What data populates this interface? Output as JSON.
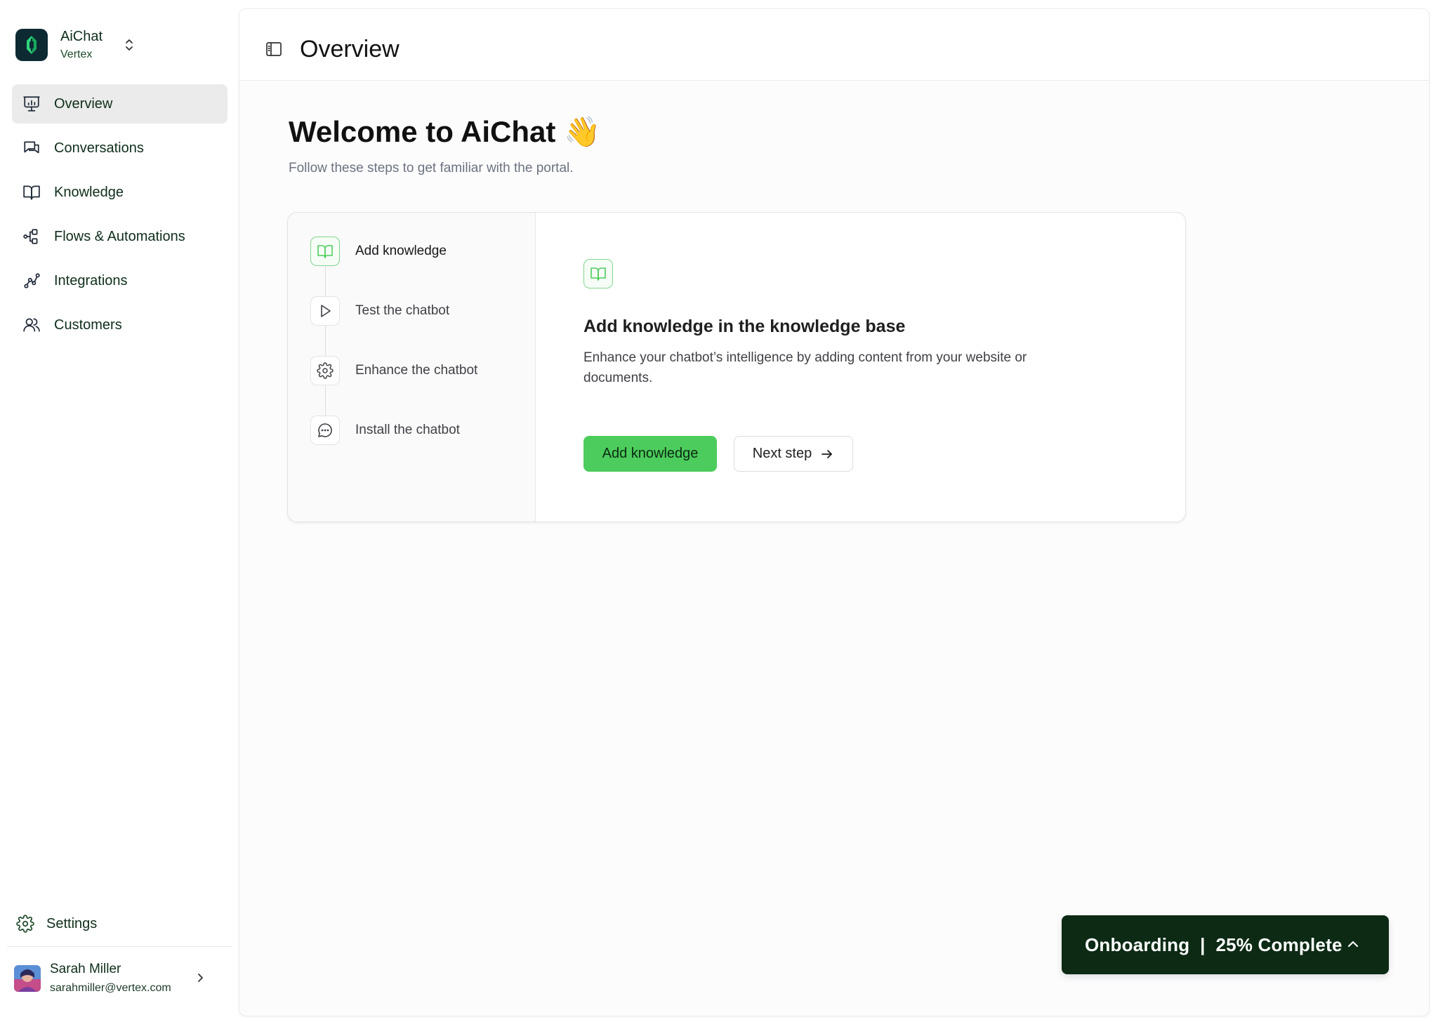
{
  "brand": {
    "name": "AiChat",
    "org": "Vertex",
    "accent": "#4ccc5c",
    "logo_bg": "#0d2a33"
  },
  "sidebar": {
    "items": [
      {
        "label": "Overview",
        "icon": "presentation-board-icon",
        "active": true
      },
      {
        "label": "Conversations",
        "icon": "chat-bubbles-icon",
        "active": false
      },
      {
        "label": "Knowledge",
        "icon": "open-book-icon",
        "active": false
      },
      {
        "label": "Flows & Automations",
        "icon": "flow-nodes-icon",
        "active": false
      },
      {
        "label": "Integrations",
        "icon": "connected-nodes-icon",
        "active": false
      },
      {
        "label": "Customers",
        "icon": "users-icon",
        "active": false
      }
    ],
    "settings_label": "Settings"
  },
  "user": {
    "name": "Sarah Miller",
    "email": "sarahmiller@vertex.com"
  },
  "header": {
    "title": "Overview"
  },
  "welcome": {
    "title": "Welcome to AiChat 👋",
    "subtitle": "Follow these steps to get familiar with the portal."
  },
  "steps": [
    {
      "label": "Add knowledge",
      "icon": "open-book-icon",
      "active": true
    },
    {
      "label": "Test the chatbot",
      "icon": "play-icon",
      "active": false
    },
    {
      "label": "Enhance the chatbot",
      "icon": "gear-icon",
      "active": false
    },
    {
      "label": "Install the chatbot",
      "icon": "chat-dots-icon",
      "active": false
    }
  ],
  "detail": {
    "title": "Add knowledge in the knowledge base",
    "description": "Enhance your chatbot’s intelligence by adding content from your website or documents.",
    "primary_button": "Add knowledge",
    "secondary_button": "Next step"
  },
  "onboarding": {
    "label": "Onboarding  |  25% Complete",
    "progress_percent": 25
  }
}
